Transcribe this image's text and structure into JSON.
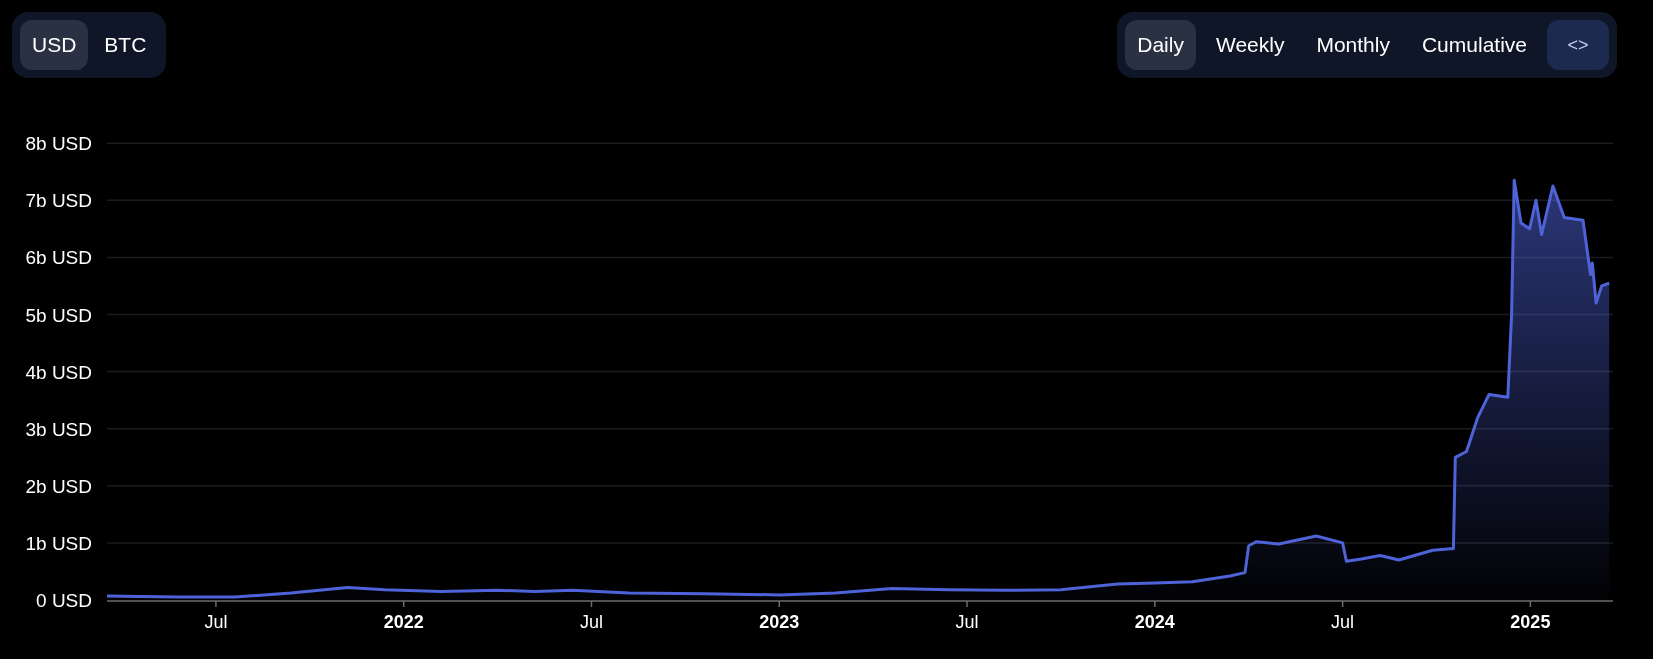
{
  "currency_tabs": [
    {
      "label": "USD",
      "selected": true
    },
    {
      "label": "BTC",
      "selected": false
    }
  ],
  "period_tabs": [
    {
      "label": "Daily",
      "selected": true
    },
    {
      "label": "Weekly",
      "selected": false
    },
    {
      "label": "Monthly",
      "selected": false
    },
    {
      "label": "Cumulative",
      "selected": false
    }
  ],
  "embed_button": {
    "label": "<>"
  },
  "chart": {
    "chart_data": {
      "type": "area",
      "grid": true,
      "xlim": [
        2021.21,
        2025.22
      ],
      "ylim": [
        0,
        8
      ],
      "yticks": [
        {
          "value": 0,
          "label": "0 USD"
        },
        {
          "value": 1,
          "label": "1b USD"
        },
        {
          "value": 2,
          "label": "2b USD"
        },
        {
          "value": 3,
          "label": "3b USD"
        },
        {
          "value": 4,
          "label": "4b USD"
        },
        {
          "value": 5,
          "label": "5b USD"
        },
        {
          "value": 6,
          "label": "6b USD"
        },
        {
          "value": 7,
          "label": "7b USD"
        },
        {
          "value": 8,
          "label": "8b USD"
        }
      ],
      "xticks": [
        {
          "value": 2021.5,
          "label": "Jul"
        },
        {
          "value": 2022,
          "label": "2022"
        },
        {
          "value": 2022.5,
          "label": "Jul"
        },
        {
          "value": 2023,
          "label": "2023"
        },
        {
          "value": 2023.5,
          "label": "Jul"
        },
        {
          "value": 2024,
          "label": "2024"
        },
        {
          "value": 2024.5,
          "label": "Jul"
        },
        {
          "value": 2025,
          "label": "2025"
        }
      ],
      "x": [
        2021.21,
        2021.3,
        2021.4,
        2021.55,
        2021.7,
        2021.85,
        2021.95,
        2022.1,
        2022.25,
        2022.35,
        2022.45,
        2022.6,
        2022.8,
        2023.0,
        2023.15,
        2023.3,
        2023.45,
        2023.6,
        2023.75,
        2023.9,
        2024.0,
        2024.1,
        2024.2,
        2024.24,
        2024.25,
        2024.27,
        2024.33,
        2024.43,
        2024.5,
        2024.51,
        2024.55,
        2024.6,
        2024.65,
        2024.74,
        2024.795,
        2024.8,
        2024.83,
        2024.86,
        2024.89,
        2024.94,
        2024.95,
        2024.957,
        2024.975,
        2024.998,
        2025.015,
        2025.03,
        2025.06,
        2025.09,
        2025.14,
        2025.16,
        2025.165,
        2025.175,
        2025.19,
        2025.21
      ],
      "series": [
        {
          "color": "#4f63d9",
          "values": [
            0.07,
            0.06,
            0.05,
            0.05,
            0.12,
            0.22,
            0.18,
            0.15,
            0.17,
            0.15,
            0.17,
            0.12,
            0.11,
            0.09,
            0.12,
            0.2,
            0.18,
            0.17,
            0.18,
            0.28,
            0.3,
            0.32,
            0.42,
            0.48,
            0.95,
            1.02,
            0.98,
            1.12,
            1.0,
            0.68,
            0.72,
            0.78,
            0.7,
            0.87,
            0.9,
            2.5,
            2.6,
            3.2,
            3.6,
            3.55,
            5.0,
            7.35,
            6.6,
            6.5,
            7.0,
            6.4,
            7.25,
            6.7,
            6.65,
            5.7,
            5.9,
            5.2,
            5.5,
            5.55
          ]
        }
      ]
    }
  }
}
